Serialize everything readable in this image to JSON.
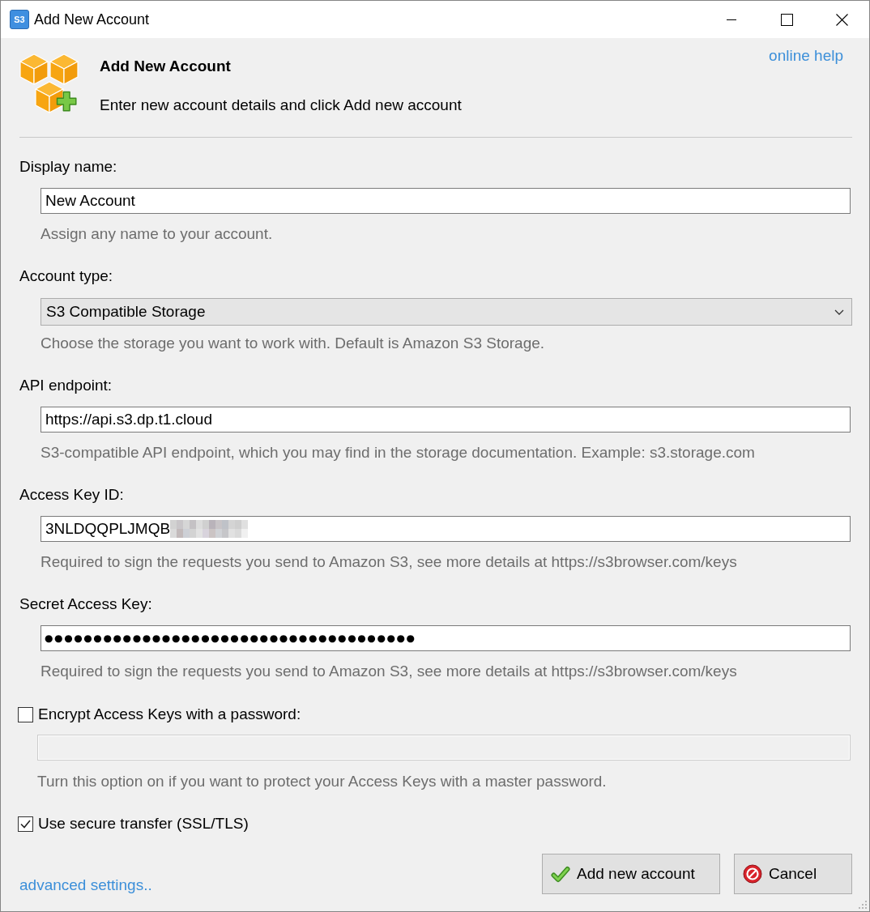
{
  "window": {
    "title": "Add New Account",
    "icon_text": "S3"
  },
  "header": {
    "title": "Add New Account",
    "subtitle": "Enter new account details and click Add new account",
    "help_link": "online help"
  },
  "fields": [
    {
      "kind": "text",
      "label": "Display name:",
      "value": "New Account",
      "redacted": false,
      "hint": "Assign any name to your account."
    },
    {
      "kind": "select",
      "label": "Account type:",
      "value": "S3 Compatible Storage",
      "redacted": false,
      "hint": "Choose the storage you want to work with. Default is Amazon S3 Storage."
    },
    {
      "kind": "text",
      "label": "API endpoint:",
      "value": "https://api.s3.dp.t1.cloud",
      "redacted": false,
      "hint": "S3-compatible API endpoint, which you may find in the storage documentation. Example: s3.storage.com"
    },
    {
      "kind": "text",
      "label": "Access Key ID:",
      "value": "3NLDQQPLJMQB",
      "redacted": true,
      "hint": "Required to sign the requests you send to Amazon S3, see more details at https://s3browser.com/keys"
    },
    {
      "kind": "password",
      "label": "Secret Access Key:",
      "value": "●●●●●●●●●●●●●●●●●●●●●●●●●●●●●●●●●●●●●●",
      "redacted": false,
      "hint": "Required to sign the requests you send to Amazon S3, see more details at https://s3browser.com/keys"
    }
  ],
  "encryption": {
    "checkbox": {
      "label": "Encrypt Access Keys with a password:",
      "checked": false
    },
    "password_field": {
      "disabled": true
    },
    "hint": "Turn this option on if you want to protect your Access Keys with a master password."
  },
  "secure_transfer": {
    "label": "Use secure transfer (SSL/TLS)",
    "checked": true
  },
  "footer": {
    "advanced_link": "advanced settings..",
    "buttons": [
      {
        "kind": "confirm",
        "label": "Add new account"
      },
      {
        "kind": "cancel",
        "label": "Cancel"
      }
    ]
  }
}
